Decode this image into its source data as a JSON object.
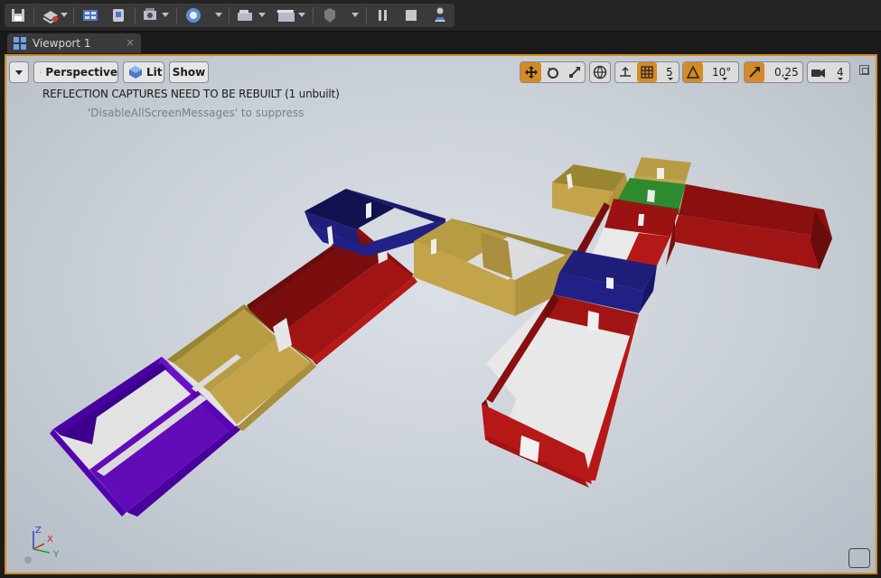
{
  "tab": {
    "title": "Viewport 1",
    "close": "×"
  },
  "viewport_toolbar": {
    "perspective_label": "Perspective",
    "lit_label": "Lit",
    "show_label": "Show",
    "grid_snap_value": "5",
    "rotation_snap_value": "10°",
    "scale_snap_value": "0,25",
    "camera_speed_value": "4"
  },
  "messages": {
    "warning": "REFLECTION CAPTURES NEED TO BE REBUILT (1 unbuilt)",
    "hint": "'DisableAllScreenMessages' to suppress"
  },
  "axis": {
    "x": "X",
    "y": "Y",
    "z": "Z"
  },
  "colors": {
    "accent": "#d38a18",
    "red": "#a11414",
    "yellow": "#c4a44a",
    "blue": "#1f1f7a",
    "purple": "#5a00b4",
    "green": "#2e8a2e"
  }
}
